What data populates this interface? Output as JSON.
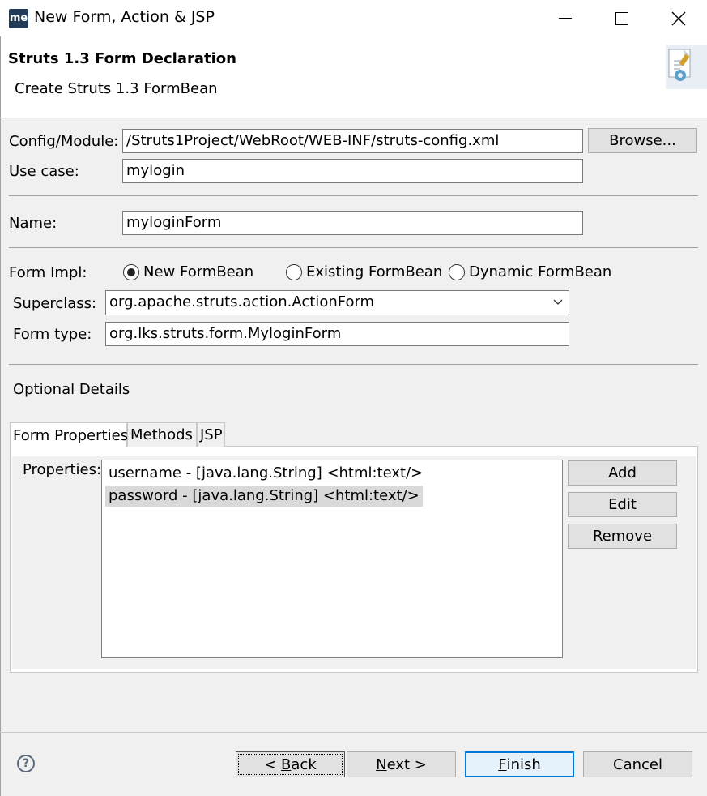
{
  "window": {
    "app_icon_text": "me",
    "title": "New Form, Action & JSP"
  },
  "header": {
    "heading": "Struts 1.3 Form Declaration",
    "description": "Create Struts 1.3 FormBean"
  },
  "config": {
    "label": "Config/Module:",
    "value": "/Struts1Project/WebRoot/WEB-INF/struts-config.xml",
    "browse_label": "Browse..."
  },
  "use_case": {
    "label": "Use case:",
    "value": "mylogin"
  },
  "name": {
    "label": "Name:",
    "value": "myloginForm"
  },
  "form_impl": {
    "label": "Form Impl:",
    "options": [
      "New FormBean",
      "Existing FormBean",
      "Dynamic FormBean"
    ],
    "selected": "New FormBean"
  },
  "superclass": {
    "label": "Superclass:",
    "value": "org.apache.struts.action.ActionForm"
  },
  "form_type": {
    "label": "Form type:",
    "value": "org.lks.struts.form.MyloginForm"
  },
  "optional": {
    "label": "Optional Details",
    "tabs": [
      "Form Properties",
      "Methods",
      "JSP"
    ],
    "active_tab": "Form Properties"
  },
  "properties": {
    "label": "Properties:",
    "items": [
      "username - [java.lang.String] <html:text/>",
      "password - [java.lang.String] <html:text/>"
    ],
    "selected_index": 1,
    "add_label": "Add",
    "edit_label": "Edit",
    "remove_label": "Remove"
  },
  "footer": {
    "help_icon": "?",
    "back_prefix": "< ",
    "back_mnemonic": "B",
    "back_rest": "ack",
    "next_mnemonic": "N",
    "next_rest": "ext >",
    "finish_mnemonic": "F",
    "finish_rest": "inish",
    "cancel_label": "Cancel"
  }
}
